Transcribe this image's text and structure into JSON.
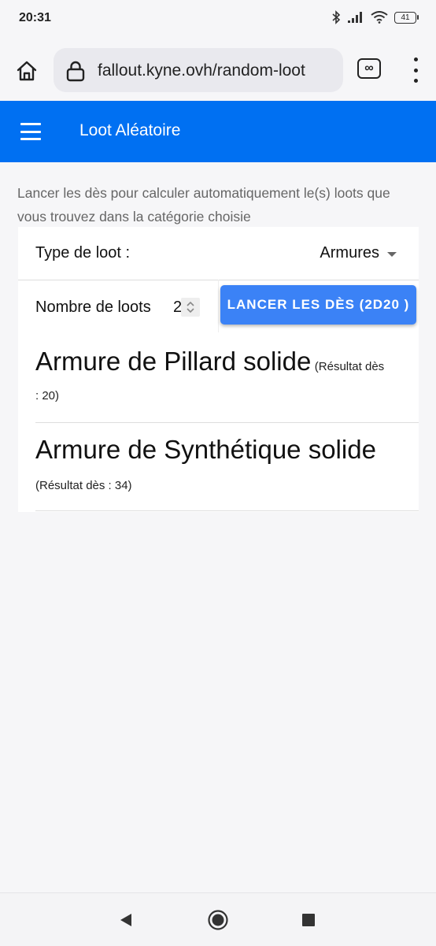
{
  "status_bar": {
    "time": "20:31",
    "battery": "41"
  },
  "browser": {
    "url": "fallout.kyne.ovh/random-loot",
    "tabs_icon_label": "∞"
  },
  "app_bar": {
    "title": "Loot Aléatoire"
  },
  "description": "Lancer les dès pour calculer automatiquement le(s) loots que vous trouvez dans la catégorie choisie",
  "form": {
    "type_label": "Type de loot :",
    "type_value": "Armures",
    "count_label": "Nombre de loots",
    "count_value": "2",
    "roll_button": "LANCER LES DÈS (2D20 )"
  },
  "results": [
    {
      "name": "Armure de Pillard solide",
      "roll_a": "(Résultat dès",
      "roll_b": ": 20)"
    },
    {
      "name": "Armure de Synthétique solide",
      "roll": "(Résultat dès : 34)"
    }
  ],
  "icons": {
    "home": "home-icon",
    "lock": "lock-icon",
    "tabs": "tabs-icon",
    "menu": "more-vert-icon",
    "hamburger": "hamburger-icon",
    "bluetooth": "bluetooth-icon",
    "signal": "signal-icon",
    "wifi": "wifi-icon"
  },
  "colors": {
    "app_bar": "#0070f2",
    "button": "#3b82f6",
    "background": "#f6f6f8"
  }
}
